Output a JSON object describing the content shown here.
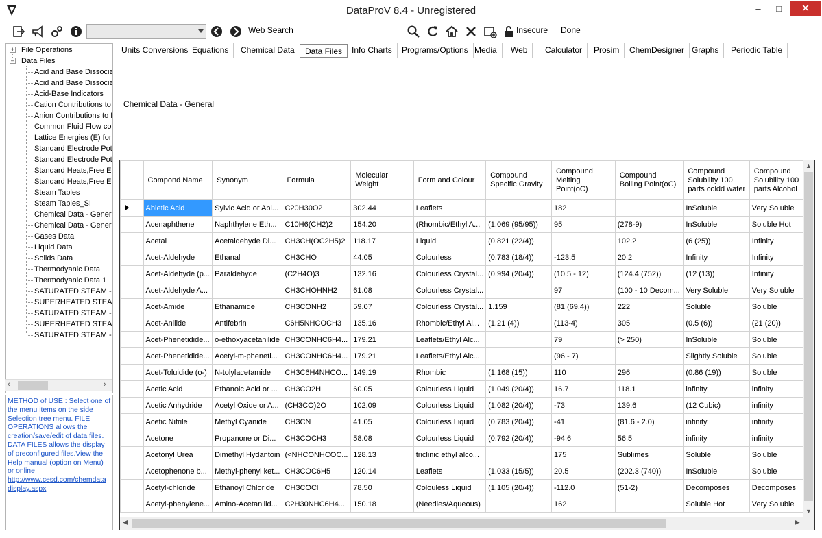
{
  "window": {
    "title": "DataProV 8.4 - Unregistered"
  },
  "toolbar": {
    "search_combo_value": "",
    "web_search_label": "Web Search",
    "insecure_label": "Insecure",
    "done_label": "Done",
    "icons": [
      "exit-icon",
      "megaphone-icon",
      "settings-gears-icon",
      "info-icon",
      "back-arrow-icon",
      "forward-arrow-icon",
      "magnifier-icon",
      "refresh-icon",
      "home-icon",
      "stop-x-icon",
      "new-window-icon",
      "lock-icon"
    ]
  },
  "tree": {
    "root1": "File Operations",
    "root2": "Data Files",
    "items": [
      "Acid and Base Dissociat",
      "Acid and Base Dissociat",
      "Acid-Base Indicators",
      "Cation Contributions to E",
      "Anion Contributions to E",
      "Common Fluid Flow conv",
      "Lattice Energies (E) for C",
      "Standard Electrode Pote",
      "Standard Electrode Pote",
      "Standard Heats,Free En",
      "Standard Heats,Free En",
      "Steam Tables",
      "Steam Tables_SI",
      "Chemical Data - General",
      "Chemical Data - General",
      "Gases Data",
      "Liquid Data",
      "Solids Data",
      "Thermodyanic Data",
      "Thermodyanic Data 1",
      "SATURATED STEAM - T",
      "SUPERHEATED STEAM",
      "SATURATED STEAM - P",
      "SUPERHEATED STEAM",
      "SATURATED STEAM - P"
    ]
  },
  "method": {
    "text": "METHOD of USE : Select one of the menu items on the side Selection tree menu. FILE OPERATIONS allows the creation/save/edit of data files. DATA FILES allows the display of preconfigured files.View the Help manual (option on Menu) or online",
    "link": "http://www.cesd.com/chemdata display.aspx"
  },
  "tabs": [
    "Units Conversions",
    "Equations",
    "Chemical Data",
    "Data Files",
    "Info Charts",
    "Programs/Options",
    "Media",
    "Web",
    "Calculator",
    "Prosim",
    "ChemDesigner",
    "Graphs",
    "Periodic Table"
  ],
  "active_tab": "Data Files",
  "content_title": "Chemical Data - General",
  "grid": {
    "columns": [
      "Compond Name",
      "Synonym",
      "Formula",
      "Molecular Weight",
      "Form and Colour",
      "Compound Specific Gravity",
      "Compound Melting Point(oC)",
      "Compound Boiling Point(oC)",
      "Compound Solubility 100 parts coldd water",
      "Compound Solubility 100 parts Alcohol"
    ],
    "rows": [
      [
        "Abietic Acid",
        "Sylvic Acid or Abi...",
        "C20H30O2",
        "302.44",
        "Leaflets",
        "",
        "182",
        "",
        "InSoluble",
        "Very Soluble"
      ],
      [
        "Acenaphthene",
        "Naphthylene Eth...",
        "C10H6(CH2)2",
        "154.20",
        "(Rhombic/Ethyl A...",
        "(1.069 (95/95))",
        "95",
        "(278-9)",
        "InSoluble",
        "Soluble Hot"
      ],
      [
        "Acetal",
        "Acetaldehyde Di...",
        "CH3CH(OC2H5)2",
        "118.17",
        "Liquid",
        "(0.821 (22/4))",
        "",
        "102.2",
        "(6 (25))",
        "Infinity"
      ],
      [
        "Acet-Aldehyde",
        "Ethanal",
        "CH3CHO",
        "44.05",
        "Colourless",
        "(0.783 (18/4))",
        "-123.5",
        "20.2",
        "Infinity",
        "Infinity"
      ],
      [
        "Acet-Aldehyde (p...",
        "Paraldehyde",
        "(C2H4O)3",
        "132.16",
        "Colourless Crystal...",
        "(0.994 (20/4))",
        "(10.5 - 12)",
        "(124.4 (752))",
        "(12 (13))",
        "Infinity"
      ],
      [
        "Acet-Aldehyde A...",
        "",
        "CH3CHOHNH2",
        "61.08",
        "Colourless Crystal...",
        "",
        "97",
        "(100 - 10 Decom...",
        "Very Soluble",
        "Very Soluble"
      ],
      [
        "Acet-Amide",
        "Ethanamide",
        "CH3CONH2",
        "59.07",
        "Colourless Crystal...",
        "1.159",
        "(81 (69.4))",
        "222",
        "Soluble",
        "Soluble"
      ],
      [
        "Acet-Anilide",
        "Antifebrin",
        "C6H5NHCOCH3",
        "135.16",
        "Rhombic/Ethyl Al...",
        "(1.21 (4))",
        "(113-4)",
        "305",
        "(0.5 (6))",
        "(21 (20))"
      ],
      [
        "Acet-Phenetidide...",
        "o-ethoxyacetanilide",
        "CH3CONHC6H4...",
        "179.21",
        "Leaflets/Ethyl Alc...",
        "",
        "79",
        "(> 250)",
        "InSoluble",
        "Soluble"
      ],
      [
        "Acet-Phenetidide...",
        "Acetyl-m-pheneti...",
        "CH3CONHC6H4...",
        "179.21",
        "Leaflets/Ethyl Alc...",
        "",
        "(96 - 7)",
        "",
        "Slightly Soluble",
        "Soluble"
      ],
      [
        "Acet-Toluidide (o-)",
        "N-tolylacetamide",
        "CH3C6H4NHCO...",
        "149.19",
        "Rhombic",
        "(1.168 (15))",
        "110",
        "296",
        "(0.86 (19))",
        "Soluble"
      ],
      [
        "Acetic Acid",
        "Ethanoic Acid or ...",
        "CH3CO2H",
        "60.05",
        "Colourless Liquid",
        "(1.049 (20/4))",
        "16.7",
        "118.1",
        "infinity",
        "infinity"
      ],
      [
        "Acetic Anhydride",
        "Acetyl Oxide or A...",
        "(CH3CO)2O",
        "102.09",
        "Colourless Liquid",
        "(1.082 (20/4))",
        "-73",
        "139.6",
        "(12 Cubic)",
        "infinity"
      ],
      [
        "Acetic Nitrile",
        "Methyl Cyanide",
        "CH3CN",
        "41.05",
        "Colourless Liquid",
        "(0.783 (20/4))",
        "-41",
        "(81.6 - 2.0)",
        "infinity",
        "infinity"
      ],
      [
        "Acetone",
        "Propanone or Di...",
        "CH3COCH3",
        "58.08",
        "Colourless Liquid",
        "(0.792 (20/4))",
        "-94.6",
        "56.5",
        "infinity",
        "infinity"
      ],
      [
        "Acetonyl Urea",
        "Dimethyl Hydantoin",
        "(<NHCONHCOC...",
        "128.13",
        "triclinic ethyl alco...",
        "",
        "175",
        "Sublimes",
        "Soluble",
        "Soluble"
      ],
      [
        "Acetophenone b...",
        "Methyl-phenyl ket...",
        "CH3COC6H5",
        "120.14",
        "Leaflets",
        "(1.033 (15/5))",
        "20.5",
        "(202.3 (740))",
        "InSoluble",
        "Soluble"
      ],
      [
        "Acetyl-chloride",
        "Ethanoyl Chloride",
        "CH3COCl",
        "78.50",
        "Colouless Liquid",
        "(1.105 (20/4))",
        "-112.0",
        "(51-2)",
        "Decomposes",
        "Decomposes"
      ],
      [
        "Acetyl-phenylene...",
        "Amino-Acetanilid...",
        "C2H30NHC6H4...",
        "150.18",
        "(Needles/Aqueous)",
        "",
        "162",
        "",
        "Soluble Hot",
        "Very Soluble"
      ]
    ]
  }
}
